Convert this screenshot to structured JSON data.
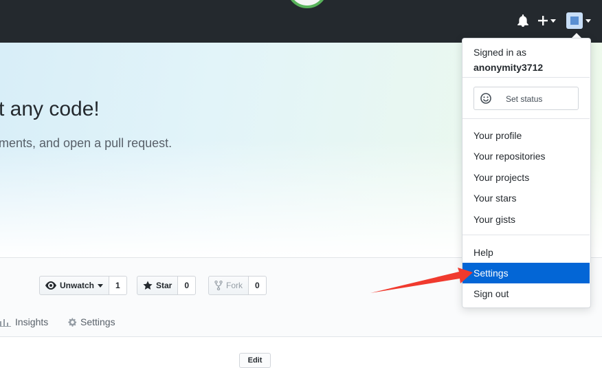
{
  "header": {
    "icons": {
      "notifications": "bell-icon",
      "create": "plus-icon",
      "avatar": "avatar-image"
    }
  },
  "hero": {
    "title": "t any code!",
    "subtitle": "ments, and open a pull request."
  },
  "repo_actions": {
    "watch": {
      "label": "Unwatch",
      "count": "1",
      "icon": "eye-icon"
    },
    "star": {
      "label": "Star",
      "count": "0",
      "icon": "star-icon"
    },
    "fork": {
      "label": "Fork",
      "count": "0",
      "icon": "fork-icon"
    }
  },
  "repo_nav": {
    "tabs": [
      {
        "label": "Insights",
        "icon": "graph-icon"
      },
      {
        "label": "Settings",
        "icon": "gear-icon"
      }
    ],
    "edit_label": "Edit"
  },
  "user_menu": {
    "signed_in_label": "Signed in as",
    "username": "anonymity3712",
    "set_status_label": "Set status",
    "items": [
      {
        "label": "Your profile"
      },
      {
        "label": "Your repositories"
      },
      {
        "label": "Your projects"
      },
      {
        "label": "Your stars"
      },
      {
        "label": "Your gists"
      }
    ],
    "secondary_items": [
      {
        "label": "Help"
      },
      {
        "label": "Settings",
        "active": true
      },
      {
        "label": "Sign out"
      }
    ]
  },
  "colors": {
    "header_bg": "#24292e",
    "active_item_bg": "#0366d6",
    "annotation_arrow": "#f03a2e"
  }
}
